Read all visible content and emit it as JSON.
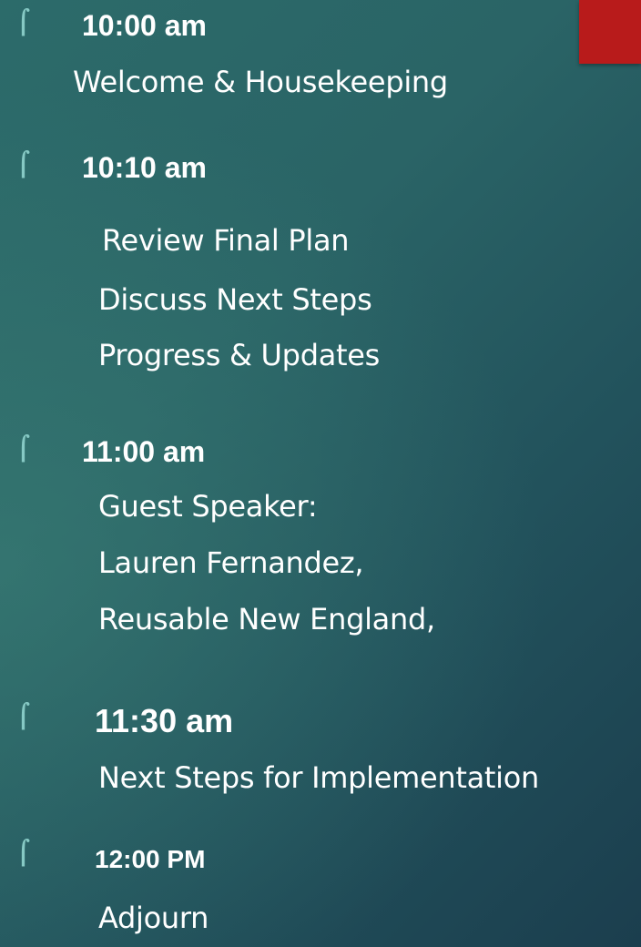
{
  "bullet_glyph": "⌠",
  "accent_color": "#b81b1b",
  "agenda": [
    {
      "time": "10:00 am",
      "items": [
        "Welcome & Housekeeping"
      ]
    },
    {
      "time": "10:10 am",
      "items": [
        "Review Final Plan",
        "Discuss Next Steps",
        "Progress & Updates"
      ]
    },
    {
      "time": "11:00 am",
      "items": [
        "Guest Speaker:",
        "Lauren Fernandez,",
        "Reusable New England,"
      ]
    },
    {
      "time": "11:30 am",
      "items": [
        "Next Steps for Implementation"
      ]
    },
    {
      "time": "12:00 PM",
      "items": [
        "Adjourn"
      ]
    }
  ]
}
